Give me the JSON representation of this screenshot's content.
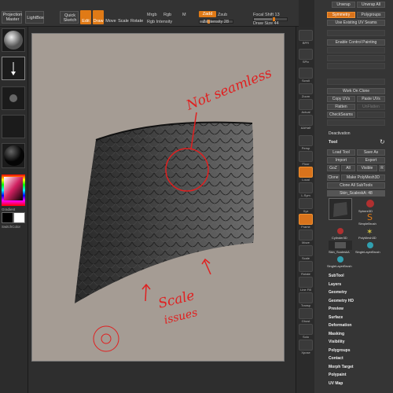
{
  "toolbar": {
    "projection_master": "Projection Master",
    "lightbox": "LightBox",
    "quick_sketch": "Quick Sketch",
    "edit": "Edit",
    "draw": "Draw",
    "move": "Move",
    "scale": "Scale",
    "rotate": "Rotate",
    "mrgb": "Mrgb",
    "rgb": "Rgb",
    "m": "M",
    "rgb_intensity": "Rgb Intensity",
    "zadd": "Zadd",
    "zsub": "Zsub",
    "z_intensity": "Z Intensity 28",
    "focal_shift": "Focal Shift 13",
    "draw_size": "Draw Size 44"
  },
  "left_shelf": {
    "gradient": "Gradient",
    "switch_color": "SwitchColor"
  },
  "canvas": {
    "annotation_not_seamless": "Not seamless",
    "annotation_scale": "Scale",
    "annotation_issues": "issues"
  },
  "right_shelf": {
    "icons": [
      "BPR",
      "SPix",
      "Scroll",
      "Zoom",
      "Actual",
      "AAHalf",
      "Persp",
      "Floor",
      "Local",
      "L.Sym",
      "Xyz",
      "Frame",
      "Move",
      "Scale",
      "Rotate",
      "Line Fill PolyF",
      "Transp",
      "Ghost",
      "Solo",
      "Xpose"
    ]
  },
  "palette": {
    "top_buttons": [
      "Unwrap",
      "Unwrap All"
    ],
    "geometry_btn": "Symmetry",
    "polygroups_btn": "Polygroups",
    "use_existing": "Use Existing UV Seams",
    "enable_control_painting": "Enable Control Painting",
    "work_on_clone": "Work On Clone",
    "copy_uvs": "Copy UVs",
    "paste_uvs": "Paste UVs",
    "flatten": "Flatten",
    "unflatten": "UnFlatten",
    "check_seams": "CheckSeams",
    "deactivation": "Deactivation",
    "tool_header": "Tool",
    "load_tool": "Load Tool",
    "save_as": "Save As",
    "import": "Import",
    "export": "Export",
    "goz": "GoZ",
    "all": "All",
    "visible": "Visible",
    "r": "R",
    "clone": "Clone",
    "make_polymesh": "Make PolyMesh3D",
    "clone_all_subtools": "Clone All SubTools",
    "current_tool": "Skin_ScaleskA: 48",
    "tools": [
      {
        "name": "Sphere3D"
      },
      {
        "name": "SimpleBrush"
      },
      {
        "name": "Cylinder3D"
      },
      {
        "name": "PolyMesh3D"
      },
      {
        "name": "Skin_ScaleskA"
      },
      {
        "name": "SingleLayerBrush"
      },
      {
        "name": "SingleLayerBrush"
      }
    ],
    "menus": [
      "SubTool",
      "Layers",
      "Geometry",
      "Geometry HD",
      "Preview",
      "Surface",
      "Deformation",
      "Masking",
      "Visibility",
      "Polygroups",
      "Contact",
      "Morph Target",
      "Polypaint",
      "UV Map"
    ]
  },
  "colors": {
    "accent": "#e07a16",
    "annotation": "#e02020",
    "canvas_bg": "#a59c94"
  }
}
